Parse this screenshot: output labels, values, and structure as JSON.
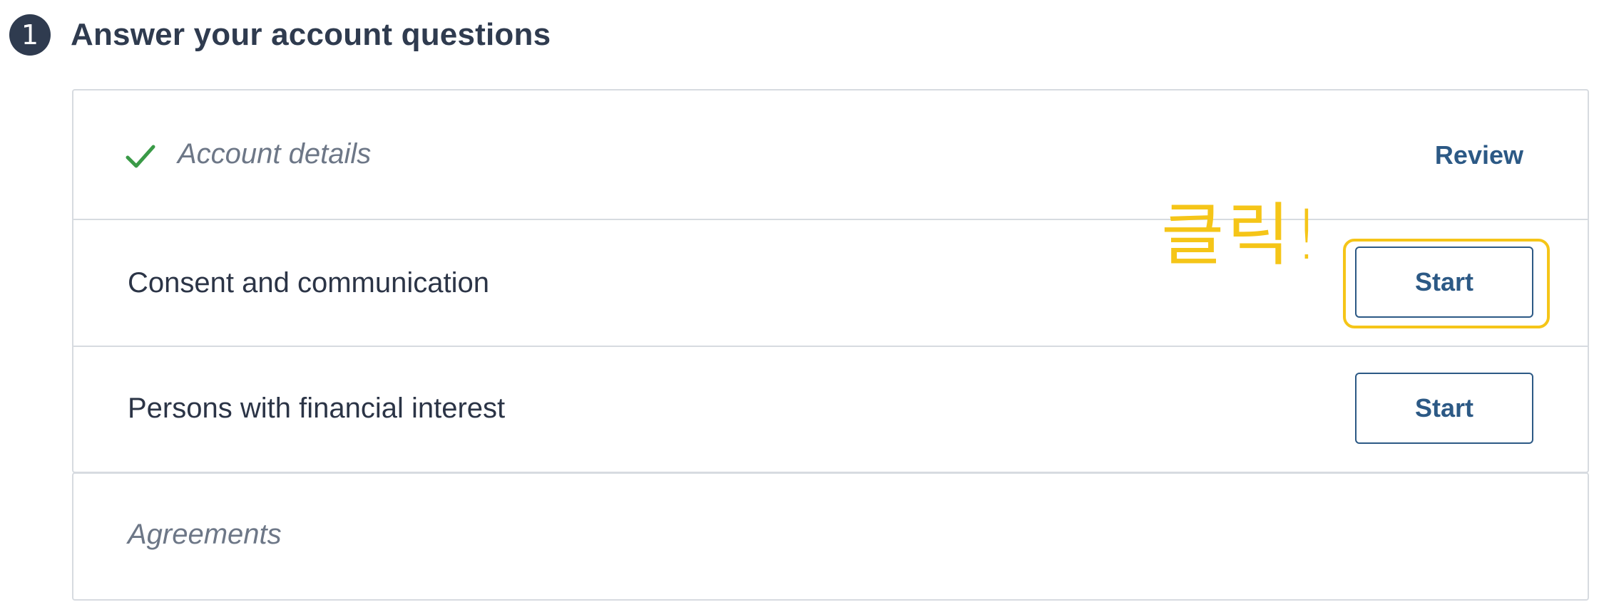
{
  "step": {
    "number": "1",
    "title": "Answer your account questions"
  },
  "rows": [
    {
      "label": "Account details",
      "status": "completed",
      "action_label": "Review"
    },
    {
      "label": "Consent and communication",
      "status": "not-started",
      "action_label": "Start"
    },
    {
      "label": "Persons with financial interest",
      "status": "not-started",
      "action_label": "Start"
    }
  ],
  "agreements": {
    "label": "Agreements",
    "status": "disabled"
  },
  "annotation": {
    "text": "클릭!",
    "color": "#f5c518"
  },
  "colors": {
    "accent": "#2c5985",
    "check": "#3a9a47",
    "badge": "#2f3b4f",
    "border": "#d7dbe0",
    "muted_text": "#6d7787"
  },
  "icons": {
    "completed": "checkmark-icon"
  }
}
